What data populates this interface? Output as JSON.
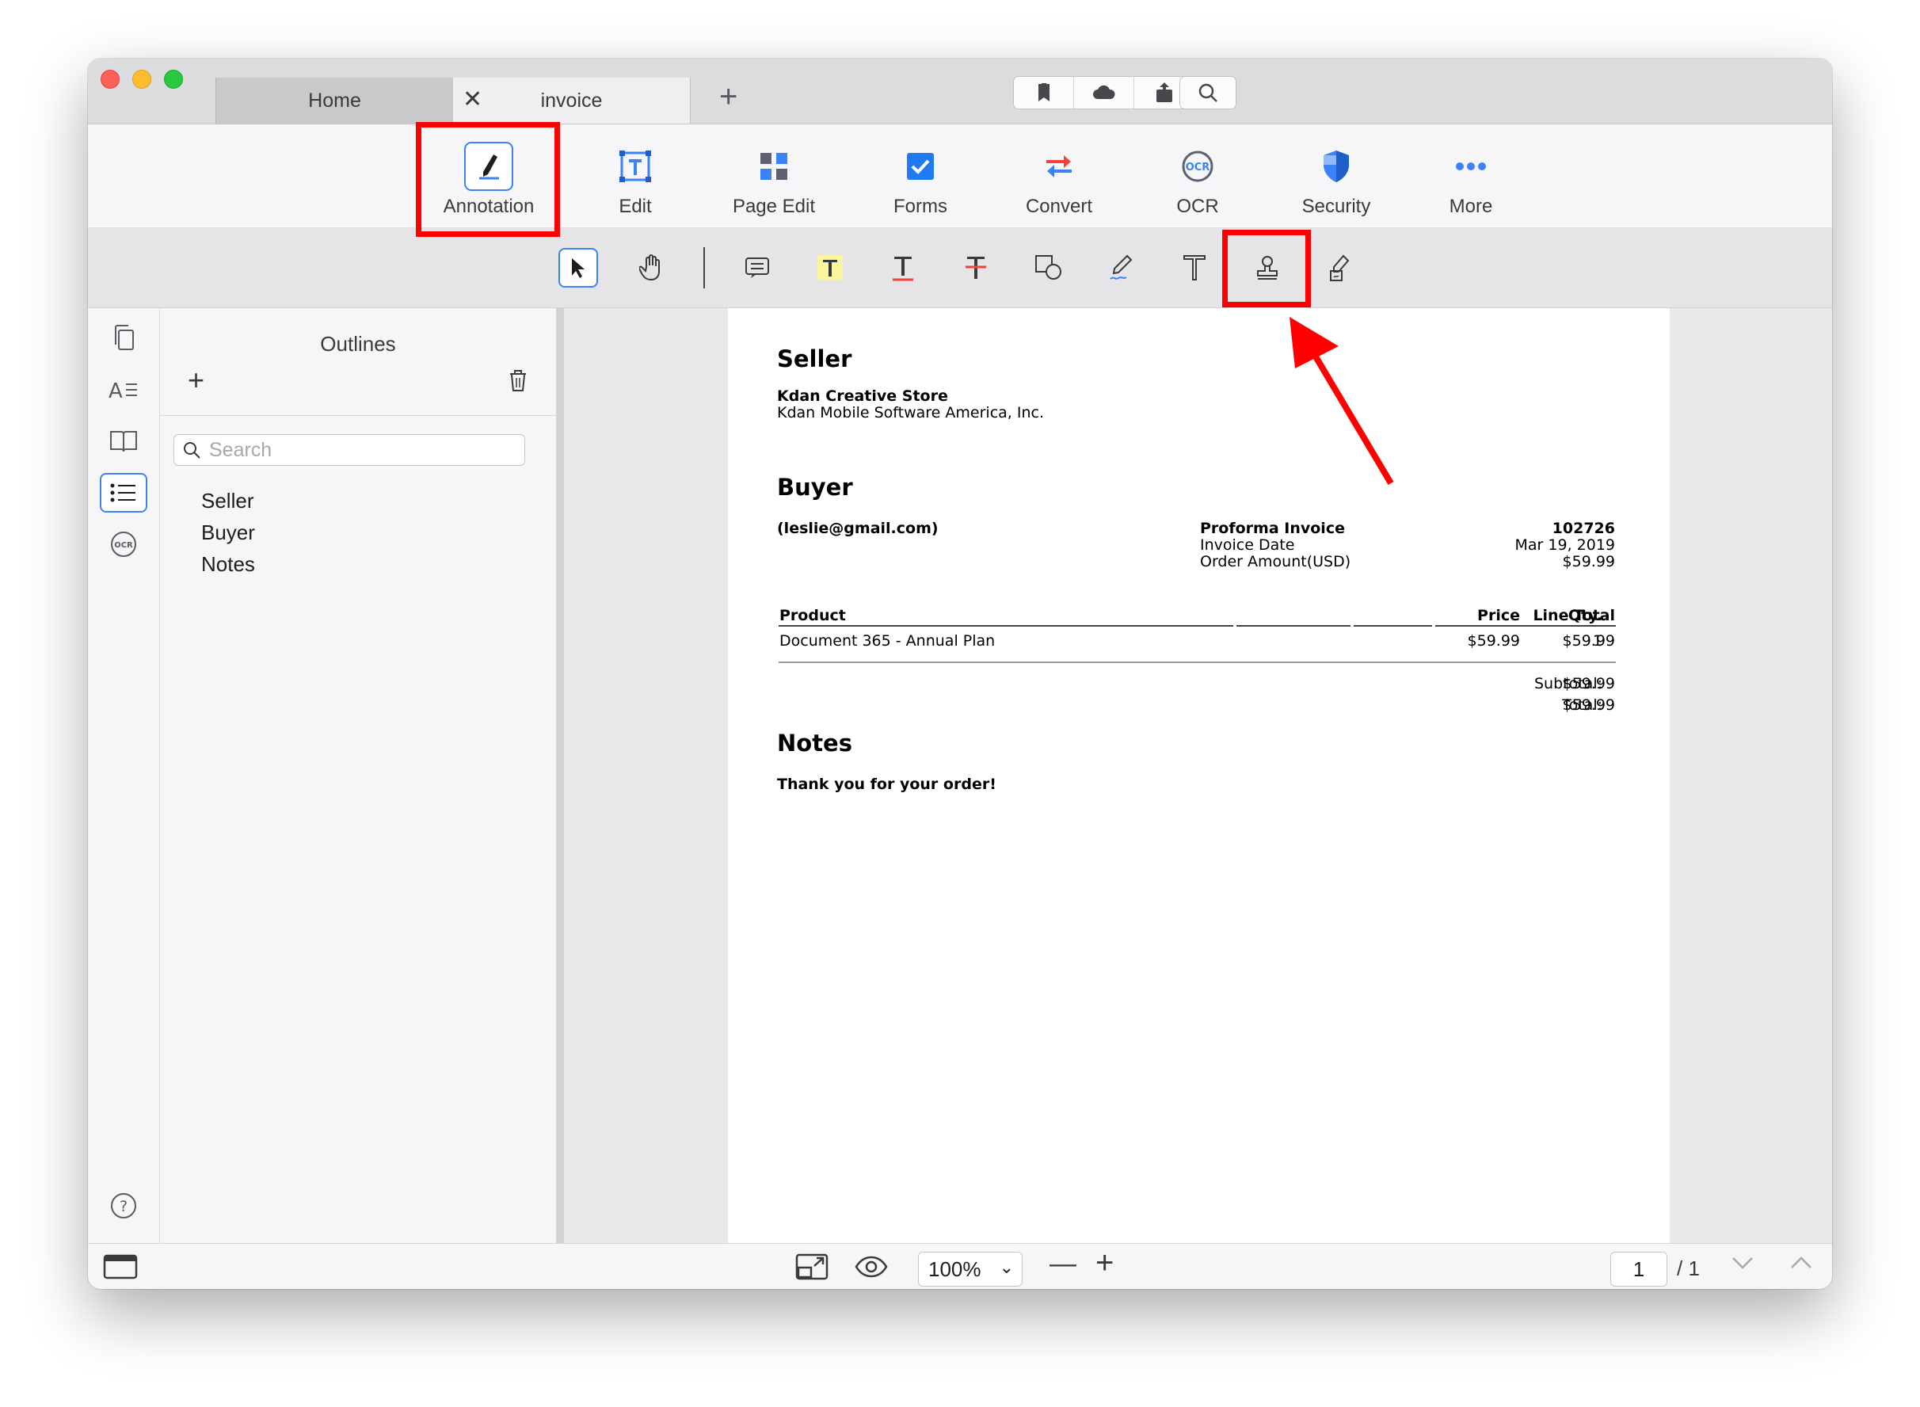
{
  "tabs": {
    "home": "Home",
    "invoice": "invoice",
    "add": "+",
    "close": "✕"
  },
  "main_toolbar": {
    "annotation": "Annotation",
    "edit": "Edit",
    "page_edit": "Page Edit",
    "forms": "Forms",
    "convert": "Convert",
    "ocr": "OCR",
    "security": "Security",
    "more": "More",
    "ocr_icon_text": "OCR"
  },
  "sub_toolbar_tools": [
    "select-tool",
    "hand-tool",
    "note-tool",
    "highlight-tool",
    "underline-tool",
    "strikeout-tool",
    "shape-tool",
    "freehand-tool",
    "text-tool",
    "stamp-tool",
    "signature-tool"
  ],
  "outlines": {
    "title": "Outlines",
    "add": "+",
    "search_placeholder": "Search",
    "items": [
      "Seller",
      "Buyer",
      "Notes"
    ]
  },
  "invoice": {
    "seller_heading": "Seller",
    "seller_name": "Kdan Creative Store",
    "seller_company": "Kdan Mobile Software America, Inc.",
    "buyer_heading": "Buyer",
    "buyer_email": "(leslie@gmail.com)",
    "proforma_label": "Proforma Invoice",
    "invoice_date_label": "Invoice Date",
    "order_amount_label": "Order Amount(USD)",
    "invoice_number": "102726",
    "invoice_date": "Mar 19, 2019",
    "order_amount": "$59.99",
    "table": {
      "headers": [
        "Product",
        "Price",
        "Qty.",
        "Line Total"
      ],
      "rows": [
        [
          "Document 365 - Annual Plan",
          "$59.99",
          "1",
          "$59.99"
        ]
      ]
    },
    "subtotal_label": "Subtotal:",
    "subtotal_value": "$59.99",
    "total_label": "Total:",
    "total_value": "$59.99",
    "notes_heading": "Notes",
    "notes_text": "Thank you for your order!"
  },
  "statusbar": {
    "zoom": "100%",
    "page_current": "1",
    "page_total": "/ 1",
    "minus": "—",
    "plus": "+"
  },
  "colors": {
    "accent": "#3b82f6",
    "highlight_box": "#ff0000",
    "highlight_yellow": "#fdf59c"
  }
}
